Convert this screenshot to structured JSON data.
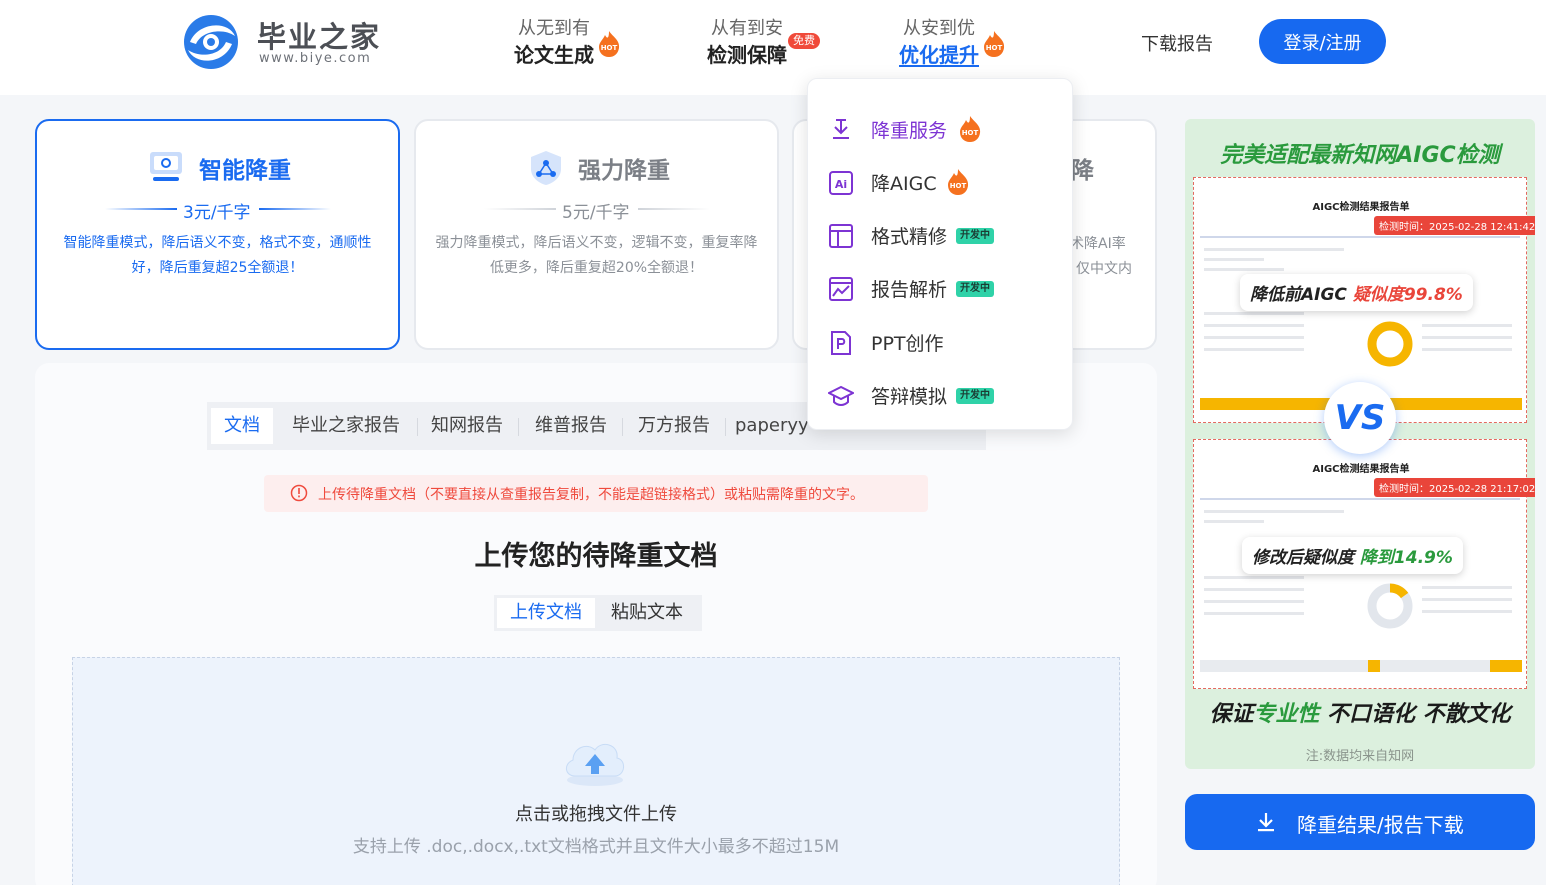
{
  "header": {
    "logo_name": "毕业之家",
    "logo_url": "www.biye.com",
    "nav": [
      {
        "sub": "从无到有",
        "main": "论文生成",
        "badge": "HOT"
      },
      {
        "sub": "从有到安",
        "main": "检测保障",
        "badge": "免费"
      },
      {
        "sub": "从安到优",
        "main": "优化提升",
        "badge": "HOT"
      }
    ],
    "download_report": "下载报告",
    "login": "登录/注册"
  },
  "cards": [
    {
      "title": "智能降重",
      "price": "3元/千字",
      "desc": "智能降重模式，降后语义不变，格式不变，通顺性好，降后重复超25全额退！"
    },
    {
      "title": "强力降重",
      "price": "5元/千字",
      "desc": "强力降重模式，降后语义不变，逻辑不变，重复率降低更多，降后重复超20%全额退！"
    },
    {
      "title": "降",
      "desc_line1": "术降AI率",
      "desc_line2": "仅中文内"
    }
  ],
  "dropdown": [
    {
      "label": "降重服务",
      "badge": "HOT",
      "icon": "rewrite-download-icon"
    },
    {
      "label": "降AIGC",
      "badge": "HOT",
      "icon": "ai-icon"
    },
    {
      "label": "格式精修",
      "badge": "开发中",
      "icon": "layout-icon"
    },
    {
      "label": "报告解析",
      "badge": "开发中",
      "icon": "chart-report-icon"
    },
    {
      "label": "PPT创作",
      "badge": "",
      "icon": "ppt-icon"
    },
    {
      "label": "答辩模拟",
      "badge": "开发中",
      "icon": "graduation-cap-icon"
    }
  ],
  "report_tabs": [
    "文档",
    "毕业之家报告",
    "知网报告",
    "维普报告",
    "万方报告",
    "paperyy"
  ],
  "notice": "上传待降重文档（不要直接从查重报告复制，不能是超链接格式）或粘贴需降重的文字。",
  "upload": {
    "title": "上传您的待降重文档",
    "modes": [
      "上传文档",
      "粘贴文本"
    ],
    "drop_text": "点击或拖拽文件上传",
    "drop_hint": "支持上传 .doc,.docx,.txt文档格式并且文件大小最多不超过15M"
  },
  "ad": {
    "headline": "完美适配最新知网AIGC检测",
    "sheet_title": "AIGC检测结果报告单",
    "time_before": "检测时间：2025-02-28 12:41:42",
    "time_after": "检测时间：2025-02-28 21:17:02",
    "before_label": "降低前AIGC",
    "before_value": "疑似度99.8%",
    "after_label": "修改后疑似度",
    "after_value": "降到14.9%",
    "vs": "VS",
    "footer_a": "保证",
    "footer_b": "专业性",
    "footer_c": " 不口语化 不散文化",
    "note": "注:数据均来自知网"
  },
  "download_button": "降重结果/报告下载",
  "colors": {
    "primary": "#1769f0",
    "accent_purple": "#7d34d3",
    "hot": "#f5711f",
    "danger": "#ef4a3d",
    "dev_badge": "#2fd2a8"
  }
}
